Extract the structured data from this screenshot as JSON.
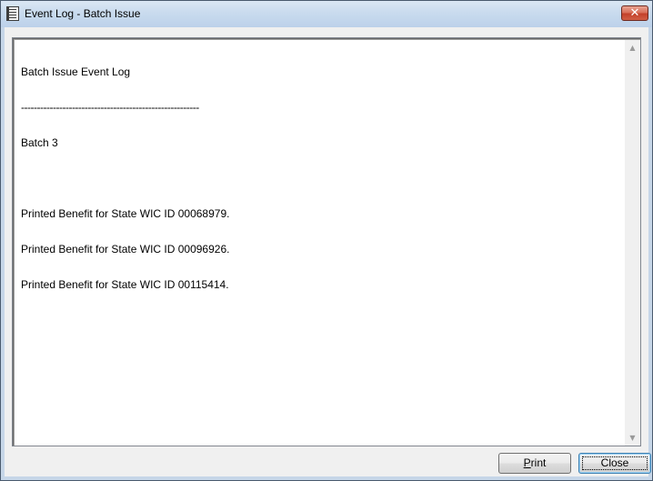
{
  "window": {
    "title": "Event Log - Batch Issue",
    "close_glyph": "✕"
  },
  "log": {
    "lines": [
      "Batch Issue Event Log",
      "--------------------------------------------------------",
      "Batch 3",
      "",
      "Printed Benefit for State WIC ID 00068979.",
      "Printed Benefit for State WIC ID 00096926.",
      "Printed Benefit for State WIC ID 00115414."
    ]
  },
  "scrollbar": {
    "up_glyph": "▲",
    "down_glyph": "▼"
  },
  "buttons": {
    "print_accel": "P",
    "print_rest": "rint",
    "close_label": "Close"
  },
  "colors": {
    "titlebar": "#c9dbee",
    "close_button": "#c4412a",
    "client_bg": "#f0f0f0"
  }
}
